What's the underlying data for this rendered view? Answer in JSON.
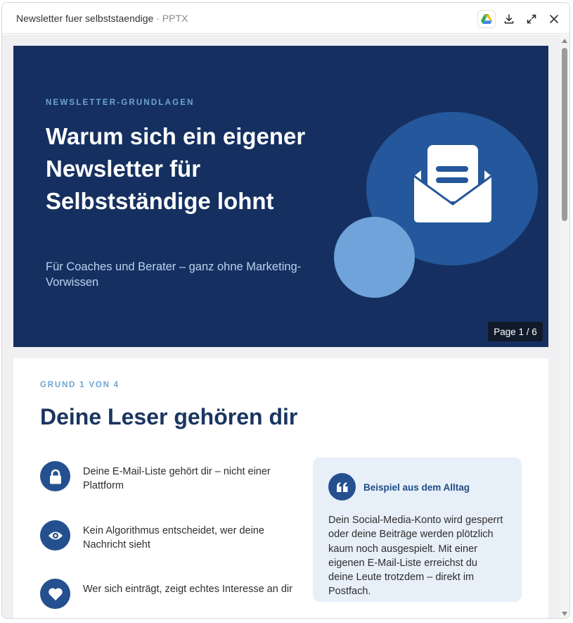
{
  "window": {
    "title": "Newsletter fuer selbststaendige",
    "file_type": "PPTX",
    "separator": "·"
  },
  "toolbar": {
    "drive_icon": "google-drive-icon",
    "download_icon": "download-icon",
    "expand_icon": "expand-icon",
    "close_icon": "close-icon"
  },
  "slide1": {
    "kicker": "NEWSLETTER-GRUNDLAGEN",
    "title": "Warum sich ein eigener Newsletter für Selbstständige lohnt",
    "subtitle": "Für Coaches und Berater – ganz ohne Marketing-Vorwissen",
    "icon": "envelope-newsletter-icon",
    "page_badge": "Page 1 / 6",
    "colors": {
      "background": "#153060",
      "circle_big": "#24579b",
      "circle_small": "#6fa3d9",
      "kicker": "#6fa4d6"
    }
  },
  "slide2": {
    "kicker": "GRUND 1 VON 4",
    "title": "Deine Leser gehören dir",
    "reasons": [
      {
        "icon": "lock-icon",
        "text": "Deine E-Mail-Liste gehört dir – nicht einer Plattform"
      },
      {
        "icon": "eye-icon",
        "text": "Kein Algorithmus entscheidet, wer deine Nachricht sieht"
      },
      {
        "icon": "heart-icon",
        "text": "Wer sich einträgt, zeigt echtes Interesse an dir"
      }
    ],
    "example_card": {
      "icon": "quote-icon",
      "title": "Beispiel aus dem Alltag",
      "body": "Dein Social-Media-Konto wird gesperrt oder deine Beiträge werden plötzlich kaum noch ausgespielt. Mit einer eigenen E-Mail-Liste erreichst du deine Leute trotzdem – direkt im Postfach."
    },
    "colors": {
      "title": "#1a3560",
      "icon_bg": "#24508f",
      "card_bg": "#e7eff9"
    }
  }
}
